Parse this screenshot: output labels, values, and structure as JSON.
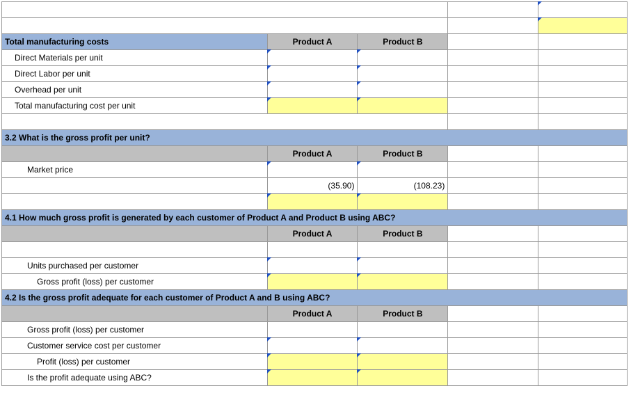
{
  "headers": {
    "productA": "Product A",
    "productB": "Product B"
  },
  "sections": {
    "totalMfg": {
      "title": "Total manufacturing costs",
      "rows": {
        "dm": "Direct Materials per unit",
        "dl": "Direct Labor per unit",
        "oh": "Overhead per unit",
        "total": "Total manufacturing cost per unit"
      }
    },
    "s32": {
      "title": "3.2  What is the gross profit per unit?",
      "rows": {
        "marketPrice": "Market price",
        "valA": "(35.90)",
        "valB": "(108.23)"
      }
    },
    "s41": {
      "title": "4.1  How much gross profit is generated by each customer of Product A and Product B using ABC?",
      "rows": {
        "units": "Units purchased per customer",
        "gp": "Gross profit (loss) per customer"
      }
    },
    "s42": {
      "title": "4.2  Is the gross profit adequate for each customer of Product A and B using ABC?",
      "rows": {
        "gp": "Gross profit (loss) per customer",
        "svc": "Customer service cost per customer",
        "profit": "Profit (loss) per customer",
        "adequate": "Is the profit adequate using ABC?"
      }
    }
  }
}
